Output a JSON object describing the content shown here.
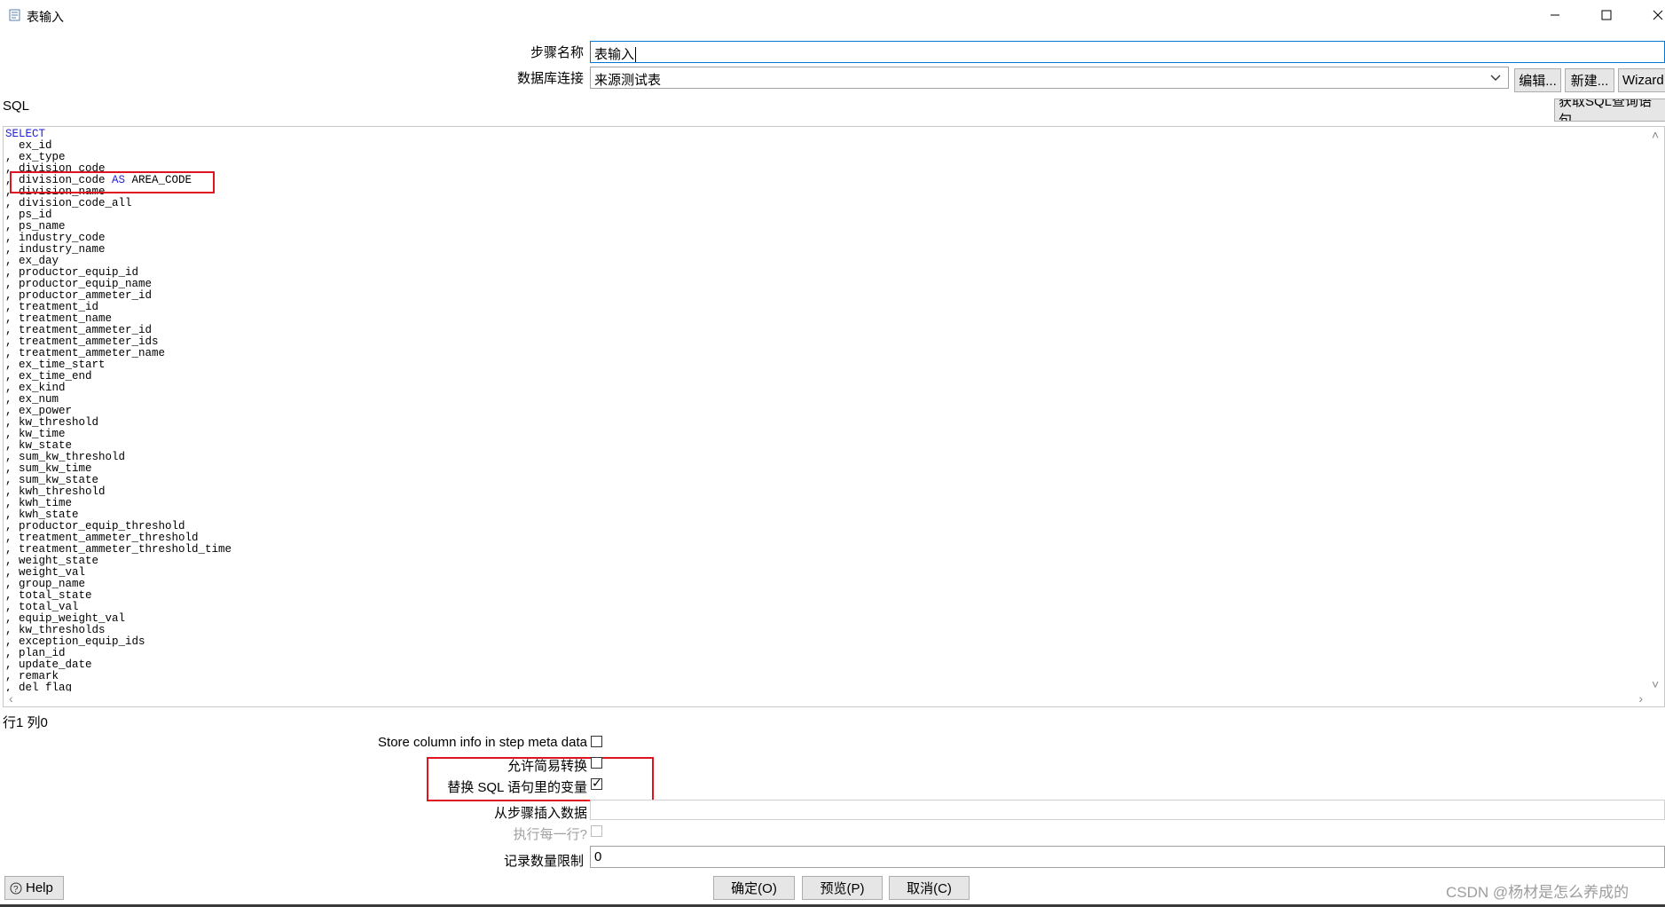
{
  "window": {
    "title": "表输入"
  },
  "form": {
    "step_name_label": "步骤名称",
    "step_name_value": "表输入",
    "db_conn_label": "数据库连接",
    "db_conn_value": "来源测试表",
    "edit_button": "编辑...",
    "new_button": "新建...",
    "wizard_button": "Wizard...",
    "get_sql_button": "获取SQL查询语句..."
  },
  "sql": {
    "label": "SQL",
    "first_keyword": "SELECT",
    "lines": [
      "  ex_id",
      ", ex_type",
      ", division_code",
      ", division_code AS AREA_CODE",
      ", division_name",
      ", division_code_all",
      ", ps_id",
      ", ps_name",
      ", industry_code",
      ", industry_name",
      ", ex_day",
      ", productor_equip_id",
      ", productor_equip_name",
      ", productor_ammeter_id",
      ", treatment_id",
      ", treatment_name",
      ", treatment_ammeter_id",
      ", treatment_ammeter_ids",
      ", treatment_ammeter_name",
      ", ex_time_start",
      ", ex_time_end",
      ", ex_kind",
      ", ex_num",
      ", ex_power",
      ", kw_threshold",
      ", kw_time",
      ", kw_state",
      ", sum_kw_threshold",
      ", sum_kw_time",
      ", sum_kw_state",
      ", kwh_threshold",
      ", kwh_time",
      ", kwh_state",
      ", productor_equip_threshold",
      ", treatment_ammeter_threshold",
      ", treatment_ammeter_threshold_time",
      ", weight_state",
      ", weight_val",
      ", group_name",
      ", total_state",
      ", total_val",
      ", equip_weight_val",
      ", kw_thresholds",
      ", exception_equip_ids",
      ", plan_id",
      ", update_date",
      ", remark",
      ", del_flag"
    ]
  },
  "status": {
    "cursor_position": "行1 列0"
  },
  "options": {
    "store_column_info_label": "Store column info in step meta data",
    "store_column_info_checked": false,
    "lazy_conversion_label": "允许简易转换",
    "lazy_conversion_checked": false,
    "replace_variables_label": "替换 SQL 语句里的变量",
    "replace_variables_checked": true,
    "insert_from_step_label": "从步骤插入数据",
    "insert_from_step_value": "",
    "execute_each_row_label": "执行每一行?",
    "execute_each_row_checked": false,
    "limit_label": "记录数量限制",
    "limit_value": "0"
  },
  "footer": {
    "help_button": "Help",
    "ok_button": "确定(O)",
    "preview_button": "预览(P)",
    "cancel_button": "取消(C)",
    "watermark": "CSDN @杨材是怎么养成的"
  },
  "colors": {
    "highlight": "#e0141e",
    "sql_keyword": "#1f1fd6",
    "focus_border": "#0078d7"
  }
}
